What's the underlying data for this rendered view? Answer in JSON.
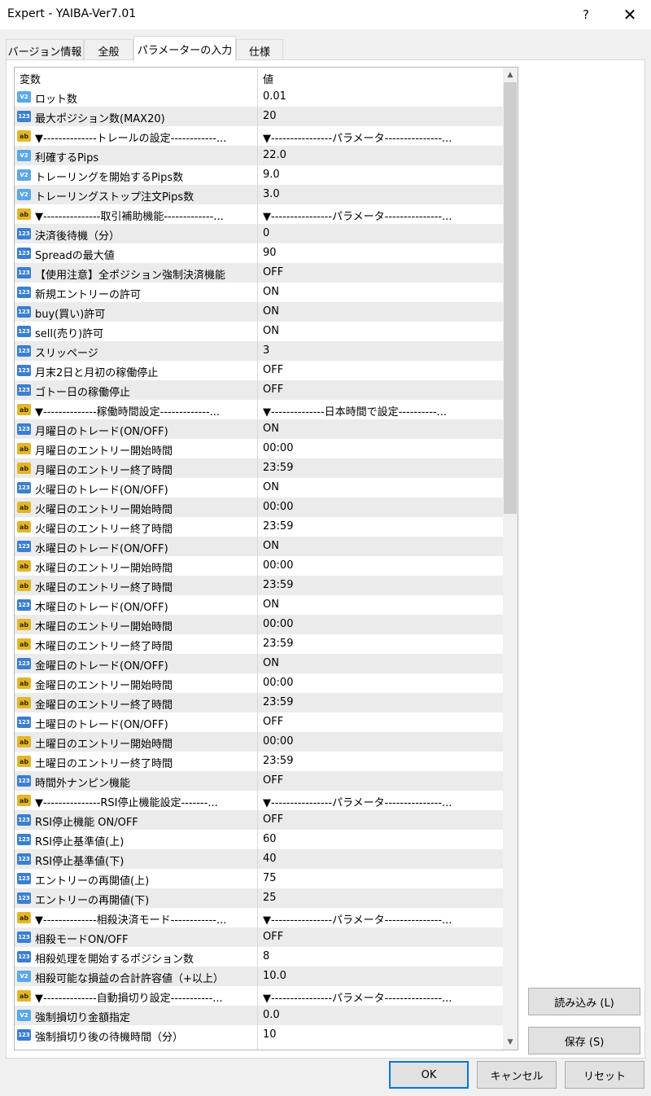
{
  "window": {
    "title": "Expert - YAIBA-Ver7.01",
    "help": "?",
    "close": "✕"
  },
  "tabs": [
    {
      "label": "バージョン情報",
      "active": false
    },
    {
      "label": "全般",
      "active": false
    },
    {
      "label": "パラメーターの入力",
      "active": true
    },
    {
      "label": "仕様",
      "active": false
    }
  ],
  "grid": {
    "columns": [
      "変数",
      "値"
    ],
    "rows": [
      {
        "icon": "double",
        "name": "ロット数",
        "value": "0.01"
      },
      {
        "icon": "int",
        "name": "最大ポジション数(MAX20)",
        "value": "20"
      },
      {
        "icon": "string",
        "name": "▼--------------トレールの設定------------...",
        "value": "▼----------------パラメータ---------------..."
      },
      {
        "icon": "double",
        "name": "利確するPips",
        "value": "22.0"
      },
      {
        "icon": "double",
        "name": "トレーリングを開始するPips数",
        "value": "9.0"
      },
      {
        "icon": "double",
        "name": "トレーリングストップ注文Pips数",
        "value": "3.0"
      },
      {
        "icon": "string",
        "name": "▼---------------取引補助機能-------------...",
        "value": "▼----------------パラメータ---------------..."
      },
      {
        "icon": "int",
        "name": "決済後待機（分）",
        "value": "0"
      },
      {
        "icon": "int",
        "name": "Spreadの最大値",
        "value": "90"
      },
      {
        "icon": "int",
        "name": "【使用注意】全ポジション強制決済機能",
        "value": "OFF"
      },
      {
        "icon": "int",
        "name": "新規エントリーの許可",
        "value": "ON"
      },
      {
        "icon": "int",
        "name": "buy(買い)許可",
        "value": "ON"
      },
      {
        "icon": "int",
        "name": "sell(売り)許可",
        "value": "ON"
      },
      {
        "icon": "int",
        "name": "スリッページ",
        "value": "3"
      },
      {
        "icon": "int",
        "name": "月末2日と月初の稼働停止",
        "value": "OFF"
      },
      {
        "icon": "int",
        "name": "ゴトー日の稼働停止",
        "value": "OFF"
      },
      {
        "icon": "string",
        "name": "▼--------------稼働時間設定-------------...",
        "value": "▼--------------日本時間で設定----------..."
      },
      {
        "icon": "int",
        "name": "月曜日のトレード(ON/OFF)",
        "value": "ON"
      },
      {
        "icon": "string",
        "name": "月曜日のエントリー開始時間",
        "value": "00:00"
      },
      {
        "icon": "string",
        "name": "月曜日のエントリー終了時間",
        "value": "23:59"
      },
      {
        "icon": "int",
        "name": "火曜日のトレード(ON/OFF)",
        "value": "ON"
      },
      {
        "icon": "string",
        "name": "火曜日のエントリー開始時間",
        "value": "00:00"
      },
      {
        "icon": "string",
        "name": "火曜日のエントリー終了時間",
        "value": "23:59"
      },
      {
        "icon": "int",
        "name": "水曜日のトレード(ON/OFF)",
        "value": "ON"
      },
      {
        "icon": "string",
        "name": "水曜日のエントリー開始時間",
        "value": "00:00"
      },
      {
        "icon": "string",
        "name": "水曜日のエントリー終了時間",
        "value": "23:59"
      },
      {
        "icon": "int",
        "name": "木曜日のトレード(ON/OFF)",
        "value": "ON"
      },
      {
        "icon": "string",
        "name": "木曜日のエントリー開始時間",
        "value": "00:00"
      },
      {
        "icon": "string",
        "name": "木曜日のエントリー終了時間",
        "value": "23:59"
      },
      {
        "icon": "int",
        "name": "金曜日のトレード(ON/OFF)",
        "value": "ON"
      },
      {
        "icon": "string",
        "name": "金曜日のエントリー開始時間",
        "value": "00:00"
      },
      {
        "icon": "string",
        "name": "金曜日のエントリー終了時間",
        "value": "23:59"
      },
      {
        "icon": "int",
        "name": "土曜日のトレード(ON/OFF)",
        "value": "OFF"
      },
      {
        "icon": "string",
        "name": "土曜日のエントリー開始時間",
        "value": "00:00"
      },
      {
        "icon": "string",
        "name": "土曜日のエントリー終了時間",
        "value": "23:59"
      },
      {
        "icon": "int",
        "name": "時間外ナンピン機能",
        "value": "OFF"
      },
      {
        "icon": "string",
        "name": "▼---------------RSI停止機能設定-------...",
        "value": "▼----------------パラメータ---------------..."
      },
      {
        "icon": "int",
        "name": "RSI停止機能 ON/OFF",
        "value": "OFF"
      },
      {
        "icon": "int",
        "name": "RSI停止基準値(上)",
        "value": "60"
      },
      {
        "icon": "int",
        "name": "RSI停止基準値(下)",
        "value": "40"
      },
      {
        "icon": "int",
        "name": "エントリーの再開値(上)",
        "value": "75"
      },
      {
        "icon": "int",
        "name": "エントリーの再開値(下)",
        "value": "25"
      },
      {
        "icon": "string",
        "name": "▼--------------相殺決済モード------------...",
        "value": "▼----------------パラメータ---------------..."
      },
      {
        "icon": "int",
        "name": "相殺モードON/OFF",
        "value": "OFF"
      },
      {
        "icon": "int",
        "name": "相殺処理を開始するポジション数",
        "value": "8"
      },
      {
        "icon": "double",
        "name": "相殺可能な損益の合計許容値（+以上）",
        "value": "10.0"
      },
      {
        "icon": "string",
        "name": "▼--------------自動損切り設定-----------...",
        "value": "▼----------------パラメータ---------------..."
      },
      {
        "icon": "double",
        "name": "強制損切り金額指定",
        "value": "0.0"
      },
      {
        "icon": "int",
        "name": "強制損切り後の待機時間（分）",
        "value": "10"
      }
    ]
  },
  "icon_labels": {
    "int": "123",
    "double": "V2",
    "string": "ab"
  },
  "buttons": {
    "load": "読み込み (L)",
    "save": "保存 (S)",
    "ok": "OK",
    "cancel": "キャンセル",
    "reset": "リセット"
  }
}
